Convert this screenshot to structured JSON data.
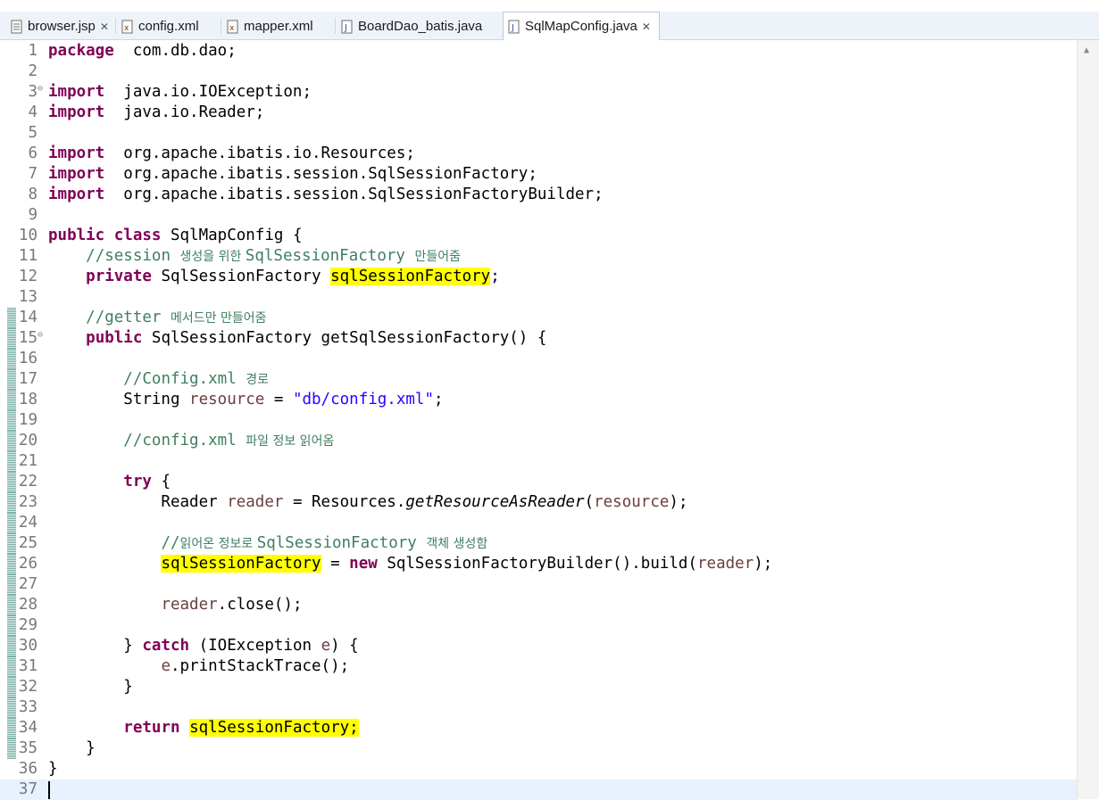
{
  "tabs": [
    {
      "label": "browser.jsp",
      "icon": "jsp-file-icon",
      "closable": true,
      "active": false
    },
    {
      "label": "config.xml",
      "icon": "xml-file-icon",
      "closable": false,
      "active": false
    },
    {
      "label": "mapper.xml",
      "icon": "xml-file-icon",
      "closable": false,
      "active": false
    },
    {
      "label": "BoardDao_batis.java",
      "icon": "java-file-icon",
      "closable": false,
      "active": false
    },
    {
      "label": "SqlMapConfig.java",
      "icon": "java-file-icon",
      "closable": true,
      "active": true
    }
  ],
  "editor": {
    "current_line": 37,
    "lines": [
      {
        "n": "1",
        "t": [
          [
            "kw",
            "package"
          ],
          [
            "",
            "  com.db.dao;"
          ]
        ]
      },
      {
        "n": "2",
        "t": []
      },
      {
        "n": "3",
        "fold": true,
        "t": [
          [
            "kw",
            "import"
          ],
          [
            "",
            "  java.io.IOException;"
          ]
        ]
      },
      {
        "n": "4",
        "t": [
          [
            "kw",
            "import"
          ],
          [
            "",
            "  java.io.Reader;"
          ]
        ]
      },
      {
        "n": "5",
        "t": []
      },
      {
        "n": "6",
        "t": [
          [
            "kw",
            "import"
          ],
          [
            "",
            "  org.apache.ibatis.io.Resources;"
          ]
        ]
      },
      {
        "n": "7",
        "t": [
          [
            "kw",
            "import"
          ],
          [
            "",
            "  org.apache.ibatis.session.SqlSessionFactory;"
          ]
        ]
      },
      {
        "n": "8",
        "t": [
          [
            "kw",
            "import"
          ],
          [
            "",
            "  org.apache.ibatis.session.SqlSessionFactoryBuilder;"
          ]
        ]
      },
      {
        "n": "9",
        "t": []
      },
      {
        "n": "10",
        "t": [
          [
            "kw",
            "public"
          ],
          [
            "",
            " "
          ],
          [
            "kw",
            "class"
          ],
          [
            "",
            " SqlMapConfig {"
          ]
        ]
      },
      {
        "n": "11",
        "t": [
          [
            "",
            "    "
          ],
          [
            "cm",
            "//session "
          ],
          [
            "cm ko",
            "생성을 위한 "
          ],
          [
            "cm",
            "SqlSessionFactory "
          ],
          [
            "cm ko",
            "만들어줌"
          ]
        ]
      },
      {
        "n": "12",
        "t": [
          [
            "",
            "    "
          ],
          [
            "kw",
            "private"
          ],
          [
            "",
            " SqlSessionFactory "
          ],
          [
            "hl",
            "sqlSessionFactory"
          ],
          [
            "",
            ";"
          ]
        ]
      },
      {
        "n": "13",
        "t": []
      },
      {
        "n": "14",
        "ref": true,
        "t": [
          [
            "",
            "    "
          ],
          [
            "cm",
            "//getter "
          ],
          [
            "cm ko",
            "메서드만 만들어줌"
          ]
        ]
      },
      {
        "n": "15",
        "ref": true,
        "fold": true,
        "t": [
          [
            "",
            "    "
          ],
          [
            "kw",
            "public"
          ],
          [
            "",
            " SqlSessionFactory getSqlSessionFactory() {"
          ]
        ]
      },
      {
        "n": "16",
        "ref": true,
        "t": []
      },
      {
        "n": "17",
        "ref": true,
        "t": [
          [
            "",
            "        "
          ],
          [
            "cm",
            "//Config.xml "
          ],
          [
            "cm ko",
            "경로"
          ]
        ]
      },
      {
        "n": "18",
        "ref": true,
        "t": [
          [
            "",
            "        String "
          ],
          [
            "var",
            "resource"
          ],
          [
            "",
            " = "
          ],
          [
            "str",
            "\"db/config.xml\""
          ],
          [
            "",
            ";"
          ]
        ]
      },
      {
        "n": "19",
        "ref": true,
        "t": []
      },
      {
        "n": "20",
        "ref": true,
        "t": [
          [
            "",
            "        "
          ],
          [
            "cm",
            "//config.xml "
          ],
          [
            "cm ko",
            "파일 정보 읽어옴"
          ]
        ]
      },
      {
        "n": "21",
        "ref": true,
        "t": []
      },
      {
        "n": "22",
        "ref": true,
        "t": [
          [
            "",
            "        "
          ],
          [
            "kw",
            "try"
          ],
          [
            "",
            " {"
          ]
        ]
      },
      {
        "n": "23",
        "ref": true,
        "t": [
          [
            "",
            "            Reader "
          ],
          [
            "var",
            "reader"
          ],
          [
            "",
            " = Resources."
          ],
          [
            "it",
            "getResourceAsReader"
          ],
          [
            "",
            "("
          ],
          [
            "var",
            "resource"
          ],
          [
            "",
            ");"
          ]
        ]
      },
      {
        "n": "24",
        "ref": true,
        "t": []
      },
      {
        "n": "25",
        "ref": true,
        "t": [
          [
            "",
            "            "
          ],
          [
            "cm",
            "//"
          ],
          [
            "cm ko",
            "읽어온 정보로 "
          ],
          [
            "cm",
            "SqlSessionFactory "
          ],
          [
            "cm ko",
            "객체 생성함"
          ]
        ]
      },
      {
        "n": "26",
        "ref": true,
        "t": [
          [
            "",
            "            "
          ],
          [
            "hl",
            "sqlSessionFactory"
          ],
          [
            "",
            " = "
          ],
          [
            "kw",
            "new"
          ],
          [
            "",
            " SqlSessionFactoryBuilder().build("
          ],
          [
            "var",
            "reader"
          ],
          [
            "",
            ");"
          ]
        ]
      },
      {
        "n": "27",
        "ref": true,
        "t": []
      },
      {
        "n": "28",
        "ref": true,
        "t": [
          [
            "",
            "            "
          ],
          [
            "var",
            "reader"
          ],
          [
            "",
            ".close();"
          ]
        ]
      },
      {
        "n": "29",
        "ref": true,
        "t": []
      },
      {
        "n": "30",
        "ref": true,
        "t": [
          [
            "",
            "        } "
          ],
          [
            "kw",
            "catch"
          ],
          [
            "",
            " (IOException "
          ],
          [
            "var",
            "e"
          ],
          [
            "",
            ") {"
          ]
        ]
      },
      {
        "n": "31",
        "ref": true,
        "t": [
          [
            "",
            "            "
          ],
          [
            "var",
            "e"
          ],
          [
            "",
            ".printStackTrace();"
          ]
        ]
      },
      {
        "n": "32",
        "ref": true,
        "t": [
          [
            "",
            "        }"
          ]
        ]
      },
      {
        "n": "33",
        "ref": true,
        "t": []
      },
      {
        "n": "34",
        "ref": true,
        "t": [
          [
            "",
            "        "
          ],
          [
            "kw",
            "return"
          ],
          [
            "",
            " "
          ],
          [
            "hl",
            "sqlSessionFactory;"
          ]
        ]
      },
      {
        "n": "35",
        "ref": true,
        "t": [
          [
            "",
            "    }"
          ]
        ]
      },
      {
        "n": "36",
        "t": [
          [
            "",
            "}"
          ]
        ]
      },
      {
        "n": "37",
        "t": []
      }
    ]
  }
}
